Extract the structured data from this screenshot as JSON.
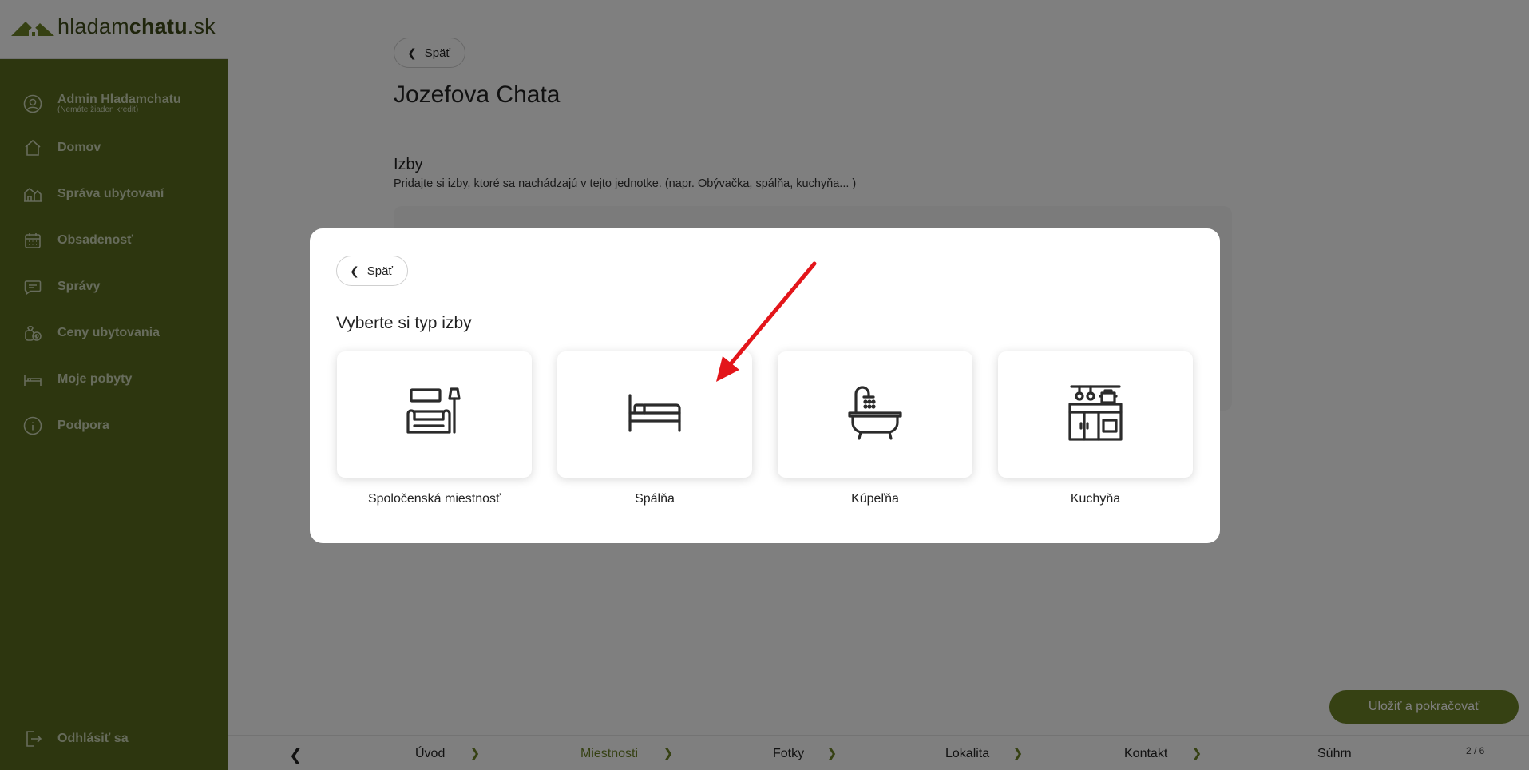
{
  "app": {
    "logo_light": "hladam",
    "logo_bold": "chatu",
    "logo_suffix": ".sk"
  },
  "sidebar": {
    "user_name": "Admin Hladamchatu",
    "user_credit": "(Nemáte žiaden kredit)",
    "items": [
      {
        "label": "Domov",
        "icon": "home-icon"
      },
      {
        "label": "Správa ubytovaní",
        "icon": "buildings-icon"
      },
      {
        "label": "Obsadenosť",
        "icon": "calendar-icon"
      },
      {
        "label": "Správy",
        "icon": "message-icon"
      },
      {
        "label": "Ceny ubytovania",
        "icon": "money-icon"
      },
      {
        "label": "Moje pobyty",
        "icon": "bed-icon"
      },
      {
        "label": "Podpora",
        "icon": "info-icon"
      }
    ],
    "logout": "Odhlásiť sa"
  },
  "page": {
    "back_label": "Späť",
    "title": "Jozefova Chata",
    "section_title": "Izby",
    "section_desc": "Pridajte si izby, ktoré sa nachádzajú v tejto jednotke. (napr. Obývačka, spálňa, kuchyňa... )"
  },
  "save_button": "Uložiť a pokračovať",
  "stepper": {
    "steps": [
      "Úvod",
      "Miestnosti",
      "Fotky",
      "Lokalita",
      "Kontakt",
      "Súhrn"
    ],
    "active_index": 1,
    "count": "2 / 6"
  },
  "modal": {
    "back_label": "Späť",
    "title": "Vyberte si typ izby",
    "options": [
      {
        "label": "Spoločenská miestnosť",
        "icon": "living-room-icon"
      },
      {
        "label": "Spálňa",
        "icon": "bed-icon"
      },
      {
        "label": "Kúpeľňa",
        "icon": "bathtub-icon"
      },
      {
        "label": "Kuchyňa",
        "icon": "kitchen-icon"
      }
    ]
  },
  "colors": {
    "sidebar": "#5a6c1f",
    "accent": "#6d8226",
    "annotation_arrow": "#e3151a"
  }
}
